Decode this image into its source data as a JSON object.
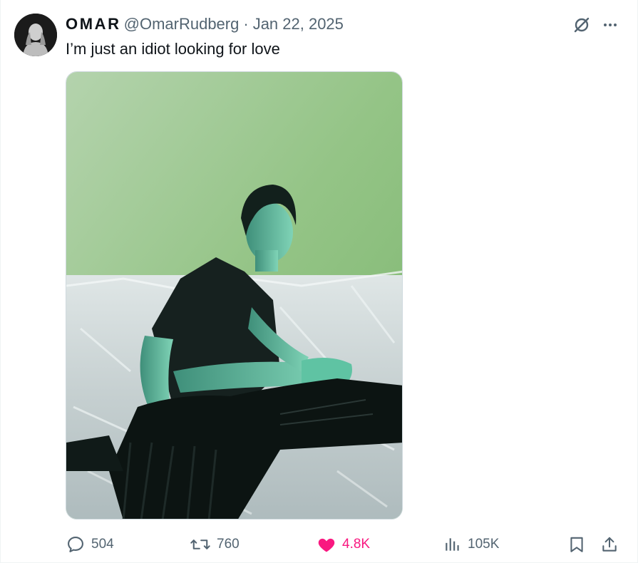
{
  "author": {
    "display_name": "OMAR",
    "handle": "@OmarRudberg",
    "separator": "·",
    "date": "Jan 22, 2025"
  },
  "tweet": {
    "text": "I’m just an idiot looking for love"
  },
  "header_actions": {
    "grok_icon": "grok-icon",
    "more_icon": "more-icon"
  },
  "metrics": {
    "replies": "504",
    "reposts": "760",
    "likes": "4.8K",
    "views": "105K"
  },
  "colors": {
    "text": "#0f1419",
    "secondary": "#536471",
    "like": "#f91880",
    "border": "#cfd9de"
  }
}
